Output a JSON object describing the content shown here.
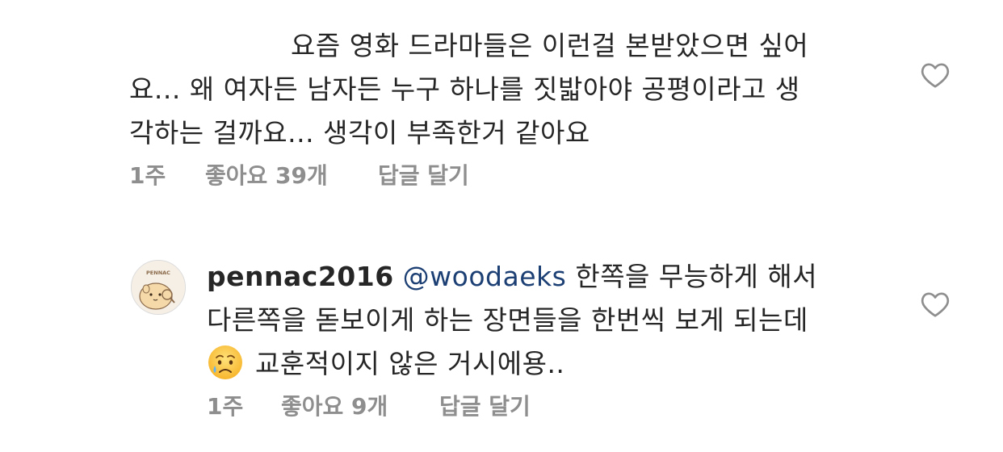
{
  "comment1": {
    "lines": [
      "요즘 영화 드라마들은 이런걸 본받았으면 싶어",
      "요... 왜 여자든 남자든 누구 하나를 짓밟아야 공평이라고 생",
      "각하는 걸까요... 생각이 부족한거 같아요"
    ],
    "age": "1주",
    "likes": "좋아요 39개",
    "reply": "답글 달기",
    "like_icon": "heart-outline-icon"
  },
  "comment2": {
    "username": "pennac2016",
    "avatar_text": "PENNAC",
    "mention": "@woodaeks",
    "line1_rest": "한쪽을 무능하게 해서",
    "line2": "다른쪽을 돋보이게 하는 장면들을 한번씩 보게 되는데",
    "emoji": "crying-face-emoji",
    "line3_rest": "교훈적이지 않은 거시에용..",
    "age": "1주",
    "likes": "좋아요 9개",
    "reply": "답글 달기",
    "like_icon": "heart-outline-icon"
  },
  "colors": {
    "text": "#262626",
    "meta": "#8e8e8e",
    "mention": "#1c3f74",
    "avatar_bg": "#f3ece3"
  }
}
